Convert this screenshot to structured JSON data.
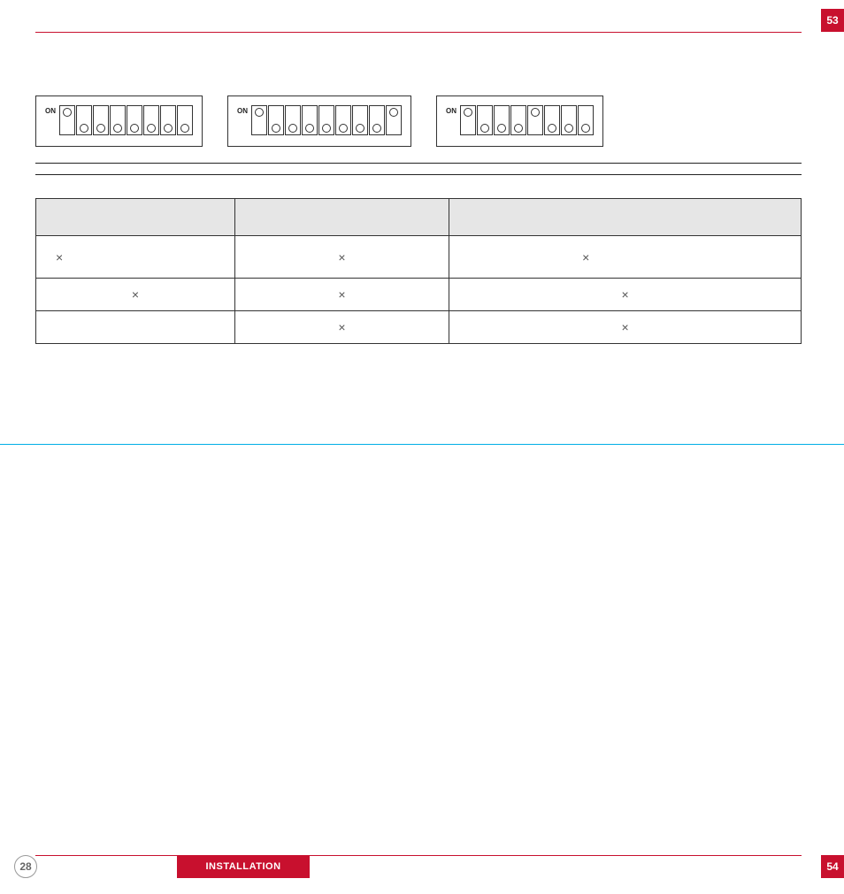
{
  "page": {
    "top_tab": "53",
    "bottom_tab": "54",
    "footer_circle": "28",
    "footer_section": "INSTALLATION"
  },
  "dip": {
    "on_label": "ON",
    "banks": [
      {
        "switches": [
          "up",
          "down",
          "down",
          "down",
          "down",
          "down",
          "down",
          "down"
        ]
      },
      {
        "switches": [
          "up",
          "down",
          "down",
          "down",
          "down",
          "down",
          "down",
          "down",
          "up"
        ]
      },
      {
        "switches": [
          "up",
          "down",
          "down",
          "down",
          "up",
          "down",
          "down",
          "down"
        ]
      }
    ]
  },
  "cross_glyph": "×",
  "table": {
    "headers": [
      "",
      "",
      ""
    ],
    "rows": [
      {
        "c1": "×",
        "c2": "×",
        "c3": "×"
      },
      {
        "c1": "×",
        "c2": "×",
        "c3": "×"
      },
      {
        "c1": "",
        "c2": "×",
        "c3": "×"
      }
    ]
  }
}
